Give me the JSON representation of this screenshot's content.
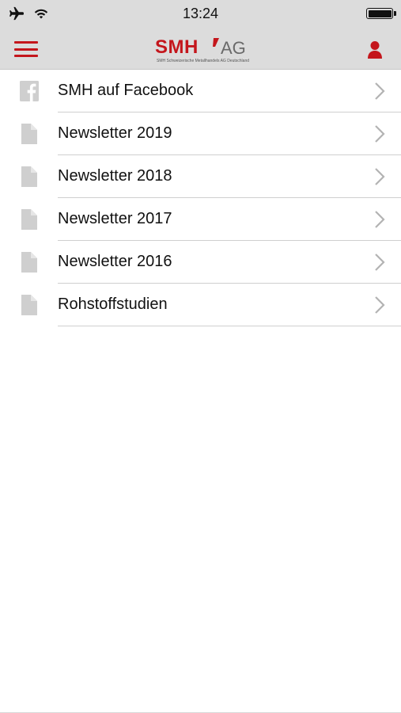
{
  "status_bar": {
    "time": "13:24",
    "icons": [
      "airplane-icon",
      "wifi-icon",
      "battery-icon"
    ]
  },
  "nav_bar": {
    "logo_text": "SMH",
    "logo_suffix": "AG",
    "logo_subtitle": "SMH Schweizerische Metallhandels AG Deutschland",
    "menu_icon": "hamburger-menu-icon",
    "user_icon": "user-icon",
    "accent_color": "#c4161c"
  },
  "list": {
    "items": [
      {
        "label": "SMH auf Facebook",
        "icon": "facebook-icon"
      },
      {
        "label": "Newsletter 2019",
        "icon": "document-icon"
      },
      {
        "label": "Newsletter 2018",
        "icon": "document-icon"
      },
      {
        "label": "Newsletter 2017",
        "icon": "document-icon"
      },
      {
        "label": "Newsletter 2016",
        "icon": "document-icon"
      },
      {
        "label": "Rohstoffstudien",
        "icon": "document-icon"
      }
    ]
  }
}
